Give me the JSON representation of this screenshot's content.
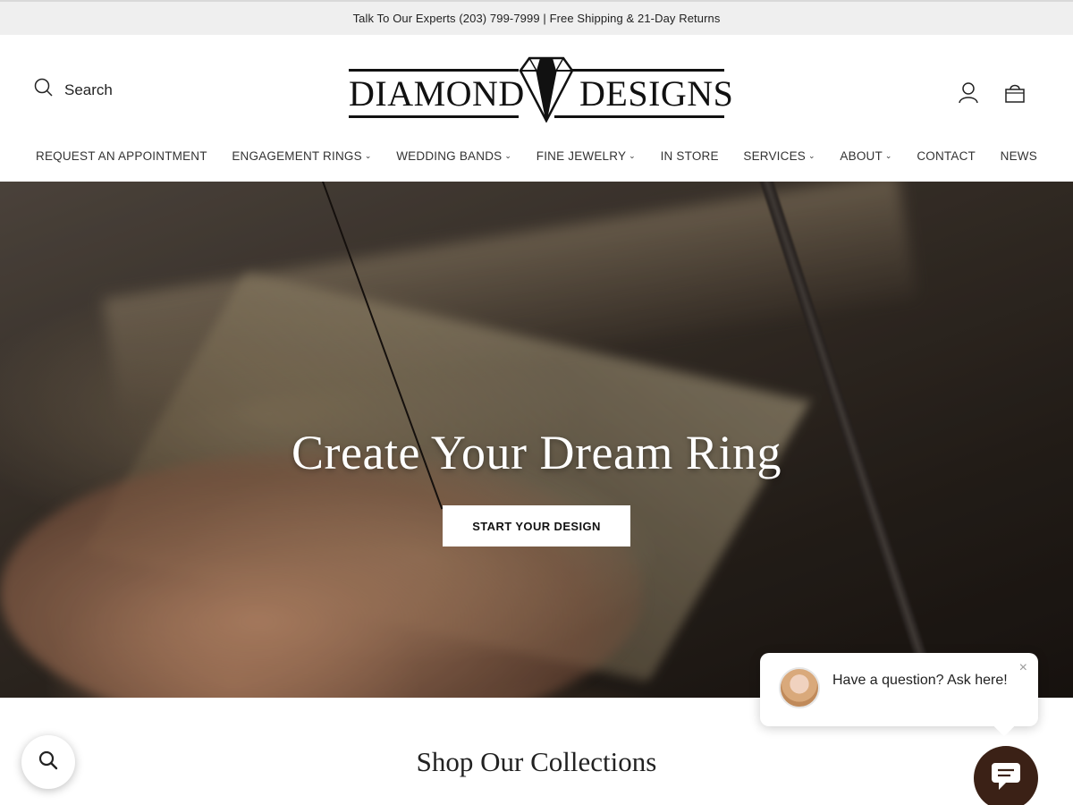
{
  "announcement": {
    "text": "Talk To Our Experts (203) 799-7999 | Free Shipping & 21-Day Returns"
  },
  "header": {
    "search_label": "Search",
    "logo": {
      "word_left": "DIAMOND",
      "word_right": "DESIGNS"
    },
    "icons": [
      "search-icon",
      "account-icon",
      "cart-icon"
    ]
  },
  "nav": {
    "items": [
      {
        "label": "REQUEST AN APPOINTMENT",
        "dropdown": false
      },
      {
        "label": "ENGAGEMENT RINGS",
        "dropdown": true
      },
      {
        "label": "WEDDING BANDS",
        "dropdown": true
      },
      {
        "label": "FINE JEWELRY",
        "dropdown": true
      },
      {
        "label": "IN STORE",
        "dropdown": false
      },
      {
        "label": "SERVICES",
        "dropdown": true
      },
      {
        "label": "ABOUT",
        "dropdown": true
      },
      {
        "label": "CONTACT",
        "dropdown": false
      },
      {
        "label": "NEWS",
        "dropdown": false
      }
    ]
  },
  "hero": {
    "title": "Create Your Dream Ring",
    "cta_label": "START YOUR DESIGN"
  },
  "collections": {
    "title": "Shop Our Collections"
  },
  "chat": {
    "message": "Have a question? Ask here!",
    "close_glyph": "×",
    "launcher_color": "#3b2116"
  }
}
